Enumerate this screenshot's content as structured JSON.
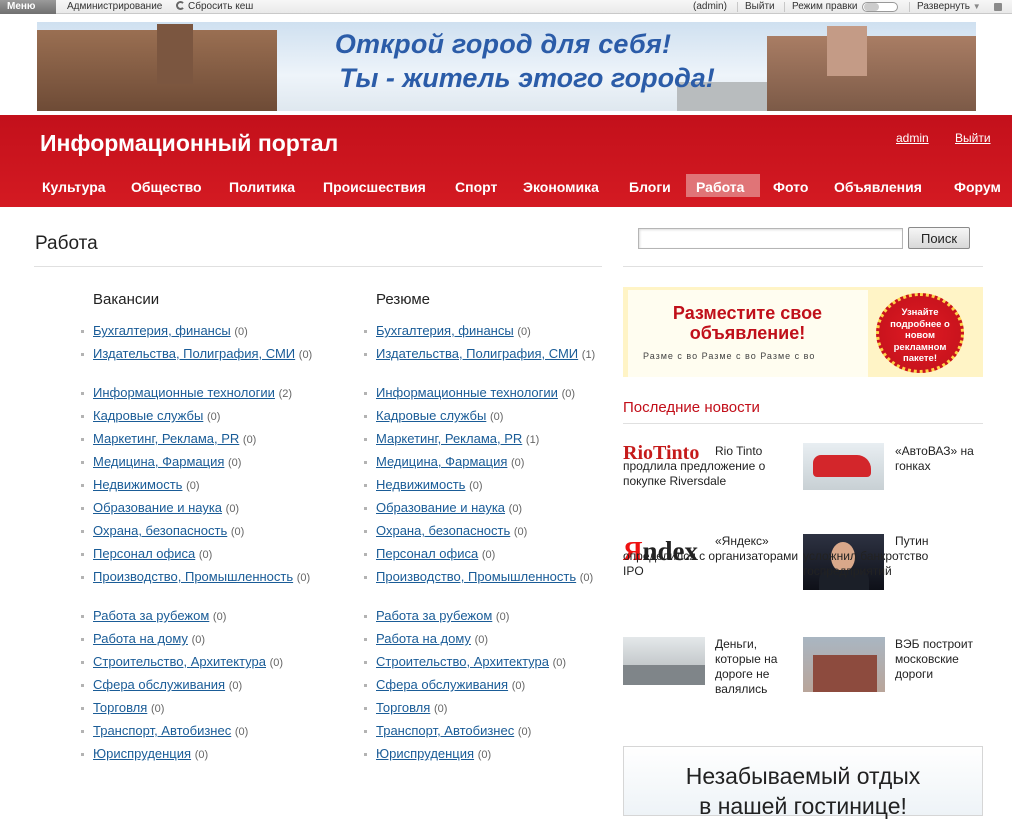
{
  "admin_bar": {
    "menu": "Меню",
    "admin_link": "Администрирование",
    "clear_cache": "Сбросить кеш",
    "user": "(admin)",
    "logout": "Выйти",
    "edit_mode": "Режим правки",
    "expand": "Развернуть"
  },
  "banner": {
    "line1": "Открой город для себя!",
    "line2": "Ты - житель этого города!"
  },
  "header": {
    "site_title": "Информационный портал",
    "user_link": "admin",
    "logout_link": "Выйти"
  },
  "nav": [
    {
      "label": "Культура"
    },
    {
      "label": "Общество"
    },
    {
      "label": "Политика"
    },
    {
      "label": "Происшествия"
    },
    {
      "label": "Спорт"
    },
    {
      "label": "Экономика"
    },
    {
      "label": "Блоги"
    },
    {
      "label": "Работа",
      "active": true
    },
    {
      "label": "Фото"
    },
    {
      "label": "Объявления"
    },
    {
      "label": "Форум"
    }
  ],
  "page": {
    "title": "Работа"
  },
  "vacancies": {
    "heading": "Вакансии",
    "items": [
      {
        "label": "Бухгалтерия, финансы",
        "count": "(0)"
      },
      {
        "label": "Издательства, Полиграфия, СМИ",
        "count": "(0)"
      },
      {
        "label": "Информационные технологии",
        "count": "(2)"
      },
      {
        "label": "Кадровые службы",
        "count": "(0)"
      },
      {
        "label": "Маркетинг, Реклама, PR",
        "count": "(0)"
      },
      {
        "label": "Медицина, Фармация",
        "count": "(0)"
      },
      {
        "label": "Недвижимость",
        "count": "(0)"
      },
      {
        "label": "Образование и наука",
        "count": "(0)"
      },
      {
        "label": "Охрана, безопасность",
        "count": "(0)"
      },
      {
        "label": "Персонал офиса",
        "count": "(0)"
      },
      {
        "label": "Производство, Промышленность",
        "count": "(0)"
      },
      {
        "label": "Работа за рубежом",
        "count": "(0)"
      },
      {
        "label": "Работа на дому",
        "count": "(0)"
      },
      {
        "label": "Строительство, Архитектура",
        "count": "(0)"
      },
      {
        "label": "Сфера обслуживания",
        "count": "(0)"
      },
      {
        "label": "Торговля",
        "count": "(0)"
      },
      {
        "label": "Транспорт, Автобизнес",
        "count": "(0)"
      },
      {
        "label": "Юриспруденция",
        "count": "(0)"
      }
    ]
  },
  "resumes": {
    "heading": "Резюме",
    "items": [
      {
        "label": "Бухгалтерия, финансы",
        "count": "(0)"
      },
      {
        "label": "Издательства, Полиграфия, СМИ",
        "count": "(1)"
      },
      {
        "label": "Информационные технологии",
        "count": "(0)"
      },
      {
        "label": "Кадровые службы",
        "count": "(0)"
      },
      {
        "label": "Маркетинг, Реклама, PR",
        "count": "(1)"
      },
      {
        "label": "Медицина, Фармация",
        "count": "(0)"
      },
      {
        "label": "Недвижимость",
        "count": "(0)"
      },
      {
        "label": "Образование и наука",
        "count": "(0)"
      },
      {
        "label": "Охрана, безопасность",
        "count": "(0)"
      },
      {
        "label": "Персонал офиса",
        "count": "(0)"
      },
      {
        "label": "Производство, Промышленность",
        "count": "(0)"
      },
      {
        "label": "Работа за рубежом",
        "count": "(0)"
      },
      {
        "label": "Работа на дому",
        "count": "(0)"
      },
      {
        "label": "Строительство, Архитектура",
        "count": "(0)"
      },
      {
        "label": "Сфера обслуживания",
        "count": "(0)"
      },
      {
        "label": "Торговля",
        "count": "(0)"
      },
      {
        "label": "Транспорт, Автобизнес",
        "count": "(0)"
      },
      {
        "label": "Юриспруденция",
        "count": "(0)"
      }
    ]
  },
  "search": {
    "button": "Поиск",
    "value": ""
  },
  "ad1": {
    "title": "Разместите свое объявление!",
    "badge": "Узнайте подробнее о новом рекламном пакете!",
    "tabs": "Разме с во   Разме с во   Разме с во"
  },
  "news": {
    "heading": "Последние новости",
    "items": [
      {
        "text": "Rio Tinto продлила предложение о покупке Riversdale",
        "logo": "RioTinto"
      },
      {
        "text": "«АвтоВАЗ» на гонках"
      },
      {
        "text": "«Яндекс» определился с организаторами IPO",
        "logo": "Яndex"
      },
      {
        "text": "Путин усложнил банкротство госпредприятий"
      },
      {
        "text": "Деньги, которые на дороге не валялись"
      },
      {
        "text": "ВЭБ построит московские дороги"
      }
    ]
  },
  "ad2": {
    "line1": "Незабываемый отдых",
    "line2": "в нашей гостинице!"
  }
}
